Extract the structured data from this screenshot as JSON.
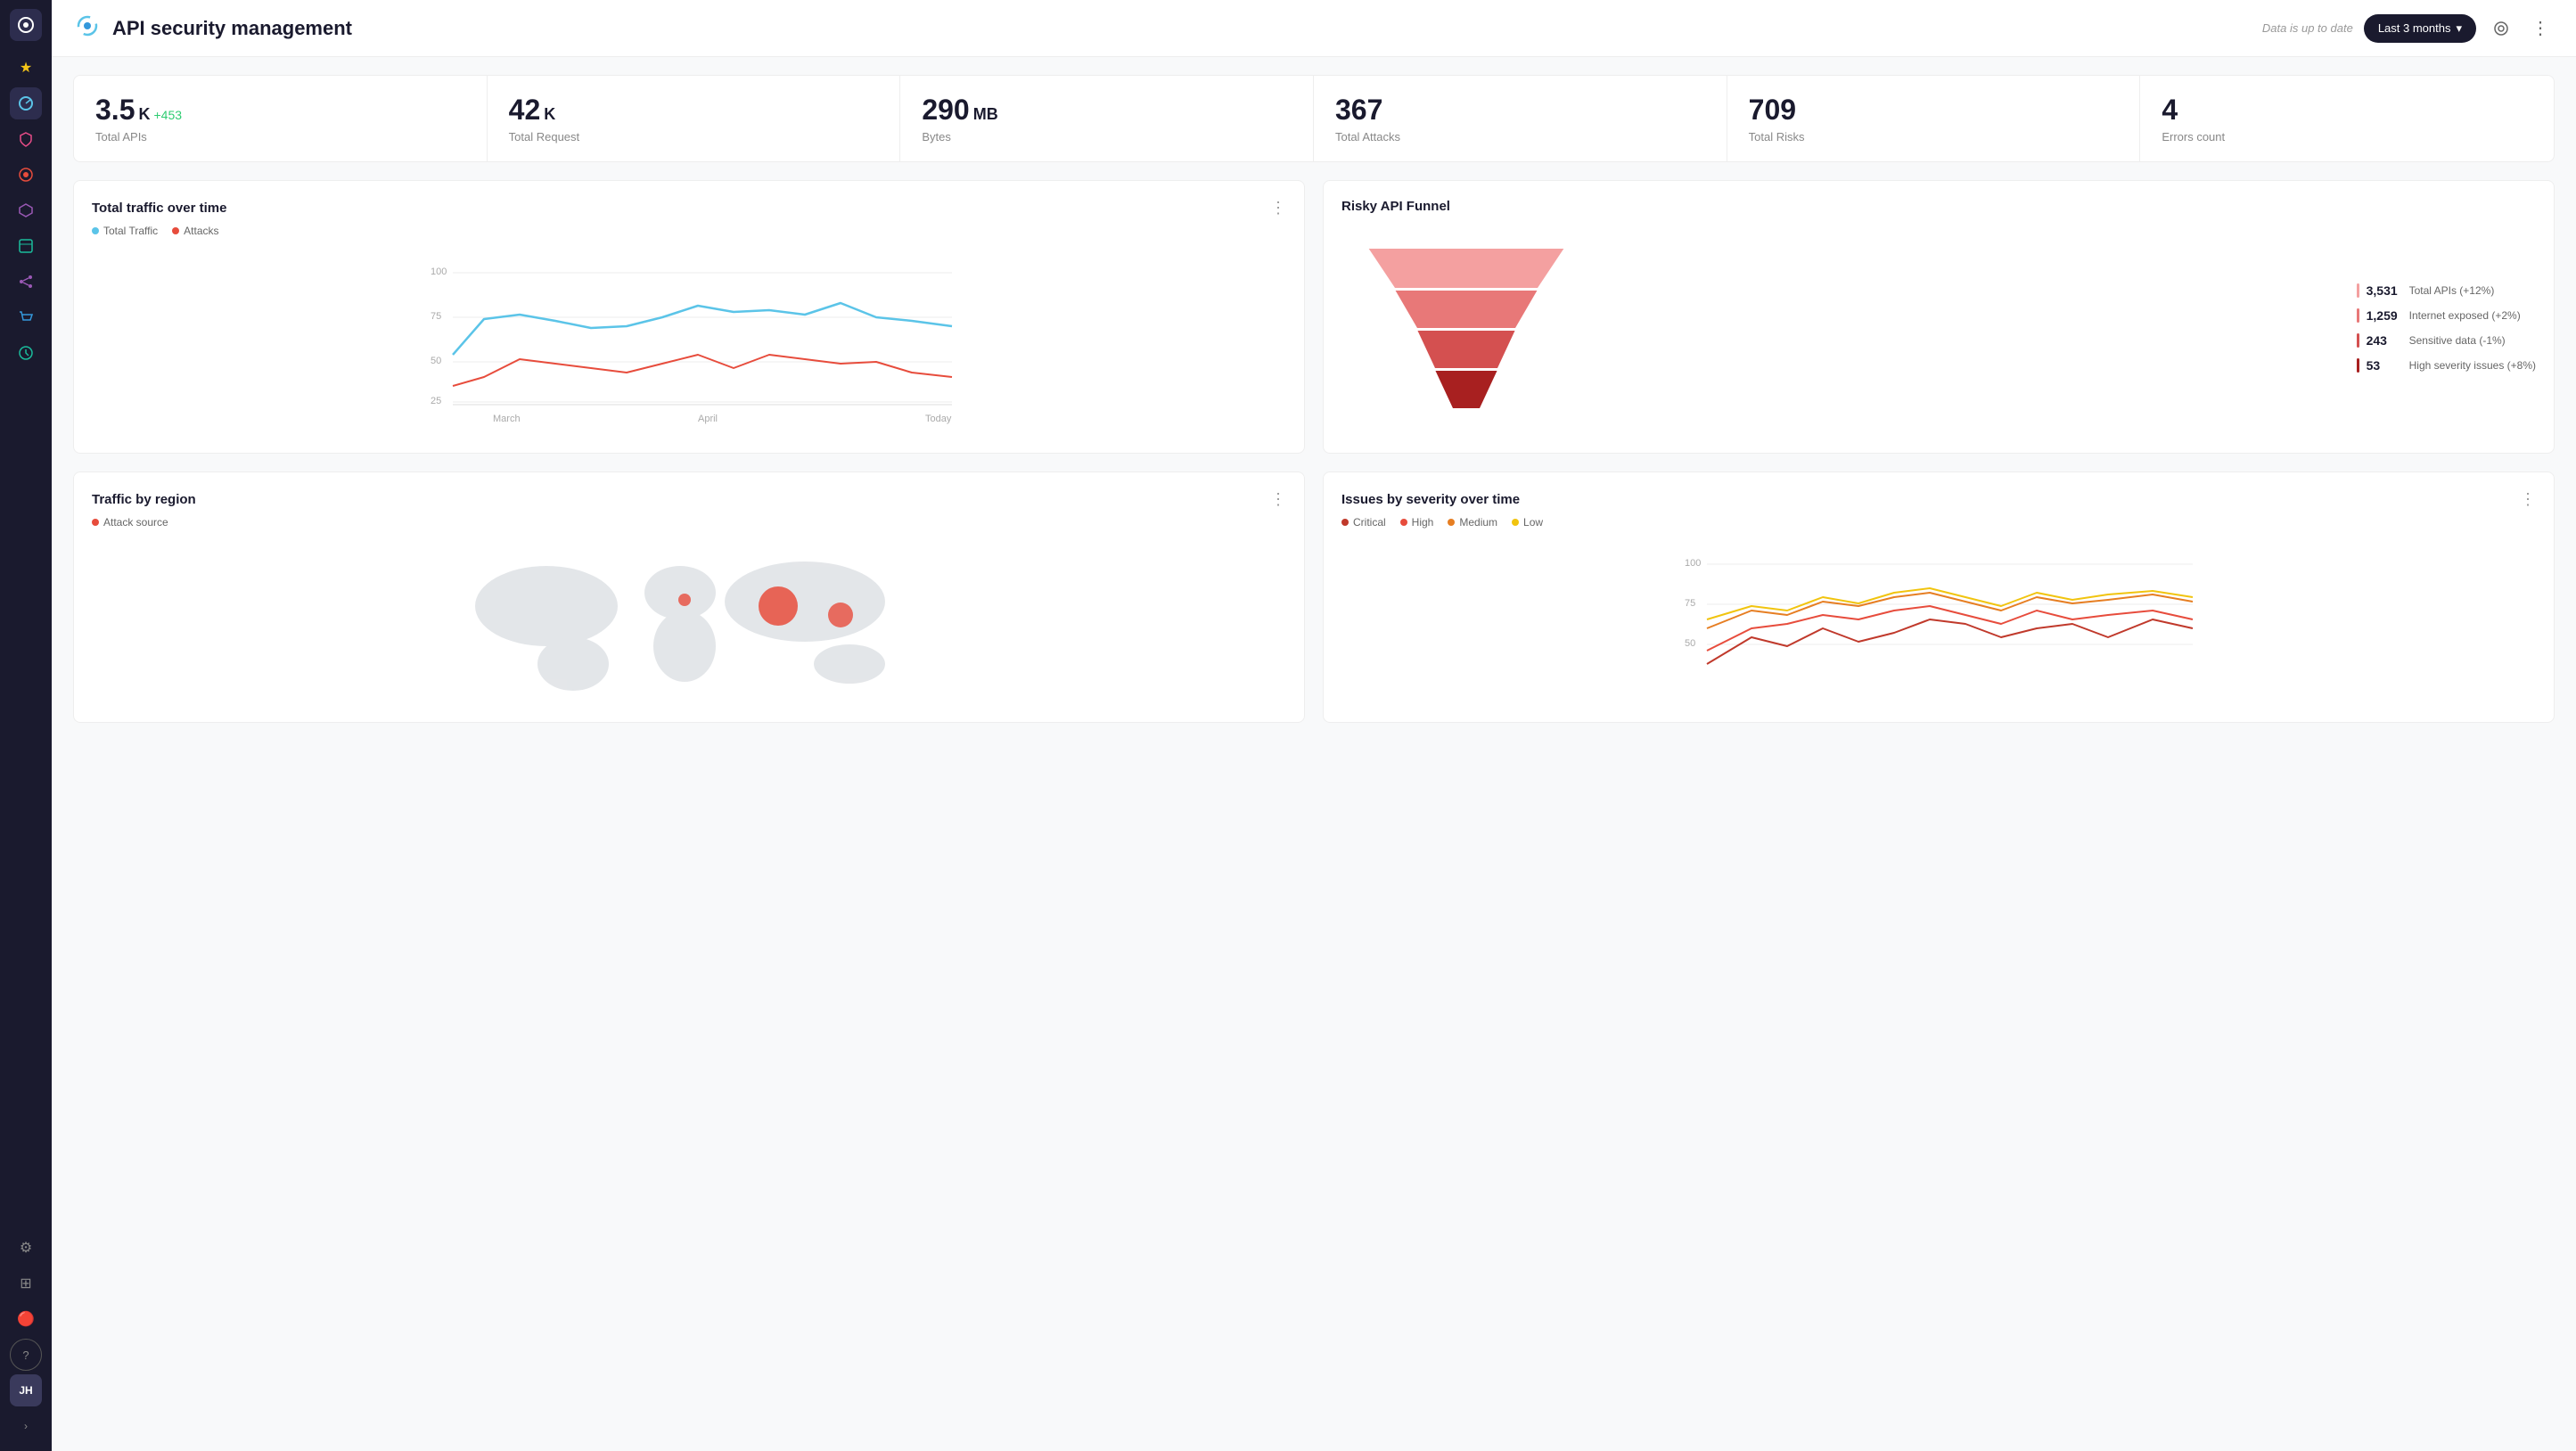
{
  "app": {
    "logo_text": "◎",
    "title": "API security management",
    "status": "Data is up to date",
    "time_filter": "Last 3 months",
    "time_filter_icon": "▾"
  },
  "sidebar": {
    "logo": "◎",
    "avatar": "JH",
    "items": [
      {
        "id": "star",
        "icon": "★",
        "active": false,
        "label": "favorites"
      },
      {
        "id": "dashboard",
        "icon": "◕",
        "active": true,
        "label": "dashboard"
      },
      {
        "id": "shield",
        "icon": "⛨",
        "active": false,
        "label": "shield"
      },
      {
        "id": "eye",
        "icon": "◉",
        "active": false,
        "label": "monitor"
      },
      {
        "id": "api",
        "icon": "⬡",
        "active": false,
        "label": "api"
      },
      {
        "id": "box",
        "icon": "▣",
        "active": false,
        "label": "inventory"
      },
      {
        "id": "graph",
        "icon": "⌬",
        "active": false,
        "label": "graph"
      },
      {
        "id": "cart",
        "icon": "⛉",
        "active": false,
        "label": "cart"
      },
      {
        "id": "circle",
        "icon": "◍",
        "active": false,
        "label": "circle"
      },
      {
        "id": "settings",
        "icon": "⚙",
        "active": false,
        "label": "settings"
      },
      {
        "id": "grid",
        "icon": "⊞",
        "active": false,
        "label": "grid"
      },
      {
        "id": "bell",
        "icon": "🔔",
        "active": false,
        "label": "notifications"
      },
      {
        "id": "help",
        "icon": "?",
        "active": false,
        "label": "help"
      }
    ],
    "expand_icon": "›"
  },
  "stats": [
    {
      "value": "3.5",
      "unit": "K",
      "change": "+453",
      "label": "Total APIs"
    },
    {
      "value": "42",
      "unit": "K",
      "change": "",
      "label": "Total Request"
    },
    {
      "value": "290",
      "unit": "MB",
      "change": "",
      "label": "Bytes"
    },
    {
      "value": "367",
      "unit": "",
      "change": "",
      "label": "Total Attacks"
    },
    {
      "value": "709",
      "unit": "",
      "change": "",
      "label": "Total Risks"
    },
    {
      "value": "4",
      "unit": "",
      "change": "",
      "label": "Errors count"
    }
  ],
  "charts": {
    "traffic": {
      "title": "Total traffic over time",
      "legend": [
        {
          "label": "Total Traffic",
          "color": "#5bc4e8"
        },
        {
          "label": "Attacks",
          "color": "#e74c3c"
        }
      ],
      "x_labels": [
        "March",
        "April",
        "Today"
      ]
    },
    "funnel": {
      "title": "Risky API Funnel",
      "items": [
        {
          "value": "3,531",
          "label": "Total APIs (+12%)"
        },
        {
          "value": "1,259",
          "label": "Internet exposed (+2%)"
        },
        {
          "value": "243",
          "label": "Sensitive data (-1%)"
        },
        {
          "value": "53",
          "label": "High severity issues (+8%)"
        }
      ]
    },
    "region": {
      "title": "Traffic by region",
      "legend_label": "Attack source",
      "legend_color": "#e74c3c"
    },
    "severity": {
      "title": "Issues by severity over time",
      "legend": [
        {
          "label": "Critical",
          "color": "#c0392b"
        },
        {
          "label": "High",
          "color": "#e74c3c"
        },
        {
          "label": "Medium",
          "color": "#e67e22"
        },
        {
          "label": "Low",
          "color": "#f1c40f"
        }
      ],
      "y_labels": [
        "100",
        "75",
        "50"
      ]
    }
  }
}
